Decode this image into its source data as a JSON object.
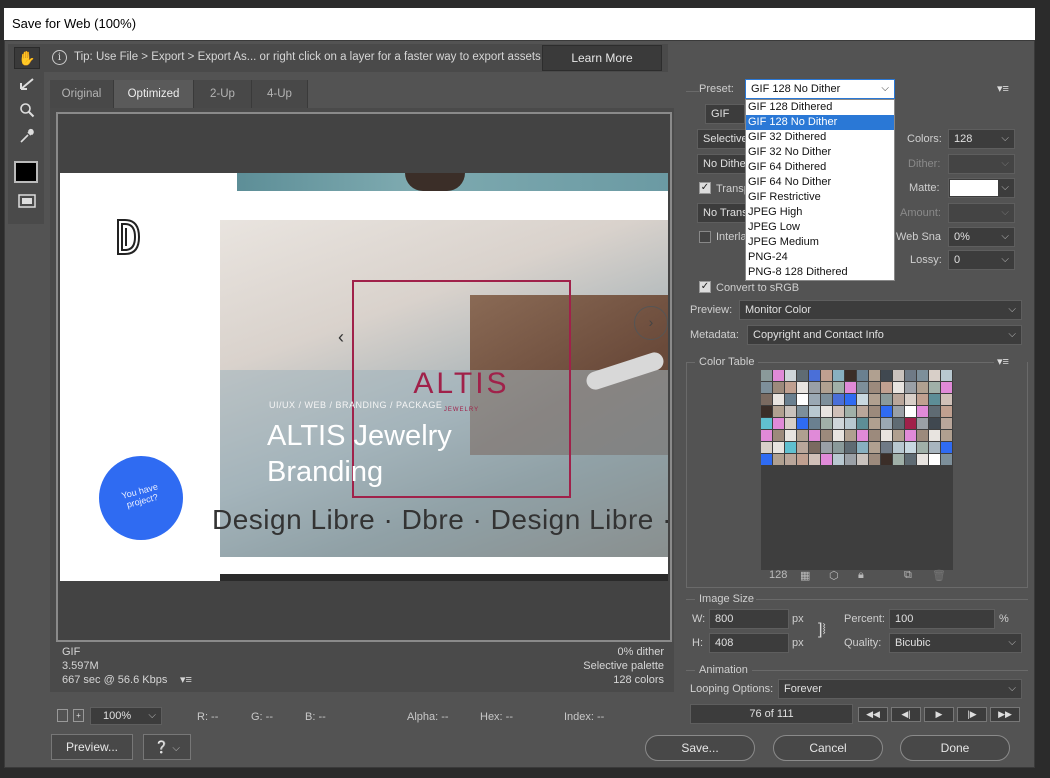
{
  "window": {
    "title": "Save for Web (100%)"
  },
  "tip": {
    "text": "Tip: Use File > Export > Export As...  or right click on a layer for a faster way to export assets",
    "learn_more": "Learn More"
  },
  "tabs": [
    {
      "label": "Original"
    },
    {
      "label": "Optimized"
    },
    {
      "label": "2-Up"
    },
    {
      "label": "4-Up"
    }
  ],
  "artwork": {
    "services": "UI/UX  /  WEB  /  BRANDING  /  PACKAGE",
    "headline1": "ALTIS Jewelry",
    "headline2": "Branding",
    "brand": "ALTIS",
    "brand_sub": "JEWELRY",
    "ticker": "Design Libre · Dbre · Design Libre · Db",
    "badge": "You have project?"
  },
  "preview_info": {
    "format": "GIF",
    "size": "3.597M",
    "speed": "667 sec @ 56.6 Kbps",
    "dither": "0% dither",
    "palette": "Selective palette",
    "colors": "128 colors"
  },
  "status": {
    "zoom": "100%",
    "r": "R: --",
    "g": "G: --",
    "b": "B: --",
    "alpha": "Alpha: --",
    "hex": "Hex: --",
    "index": "Index: --"
  },
  "buttons": {
    "preview": "Preview...",
    "save": "Save...",
    "cancel": "Cancel",
    "done": "Done"
  },
  "settings": {
    "preset_label": "Preset:",
    "preset_value": "GIF 128 No Dither",
    "format_value": "GIF",
    "reduction_value": "Selective",
    "dither_algo": "No Dither",
    "transparency_label": "Transparency",
    "transparency_dither": "No Transparency Dither",
    "interlaced_label": "Interlaced",
    "colors_label": "Colors:",
    "colors_value": "128",
    "dither_label": "Dither:",
    "matte_label": "Matte:",
    "amount_label": "Amount:",
    "websnap_label": "Web Snap:",
    "websnap_value": "0%",
    "lossy_label": "Lossy:",
    "lossy_value": "0",
    "convert_srgb": "Convert to sRGB",
    "preview_label": "Preview:",
    "preview_value": "Monitor Color",
    "metadata_label": "Metadata:",
    "metadata_value": "Copyright and Contact Info"
  },
  "preset_options": [
    "GIF 128 Dithered",
    "GIF 128 No Dither",
    "GIF 32 Dithered",
    "GIF 32 No Dither",
    "GIF 64 Dithered",
    "GIF 64 No Dither",
    "GIF Restrictive",
    "JPEG High",
    "JPEG Low",
    "JPEG Medium",
    "PNG-24",
    "PNG-8 128 Dithered"
  ],
  "color_table": {
    "title": "Color Table",
    "count": "128"
  },
  "image_size": {
    "title": "Image Size",
    "w_label": "W:",
    "w_value": "800",
    "h_label": "H:",
    "h_value": "408",
    "unit": "px",
    "percent_label": "Percent:",
    "percent_value": "100",
    "percent_unit": "%",
    "quality_label": "Quality:",
    "quality_value": "Bicubic"
  },
  "animation": {
    "title": "Animation",
    "looping_label": "Looping Options:",
    "looping_value": "Forever",
    "frame": "76 of 111"
  },
  "colors": {
    "accent_blue": "#2f6bf2",
    "altis_red": "#a0214a",
    "selection": "#2a78d6"
  }
}
